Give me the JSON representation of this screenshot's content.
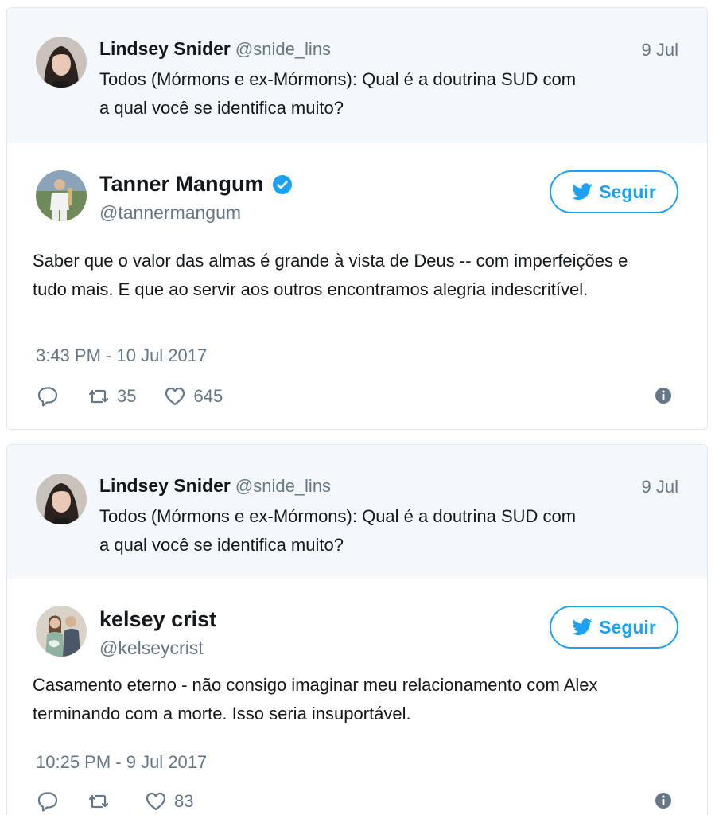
{
  "colors": {
    "accent": "#1da1f2",
    "muted": "#657786",
    "parent_bg": "#f5f8fa"
  },
  "tweets": [
    {
      "parent": {
        "name": "Lindsey Snider",
        "handle": "@snide_lins",
        "date": "9 Jul",
        "text_line1": "Todos (Mórmons e ex-Mórmons): Qual é a doutrina SUD com",
        "text_line2": "a qual você se identifica muito?"
      },
      "author": {
        "name": "Tanner Mangum",
        "handle": "@tannermangum",
        "verified": true,
        "follow_label": "Seguir"
      },
      "text_line1": "Saber que o valor das almas é grande à vista de Deus -- com imperfeições e",
      "text_line2": "tudo mais. E que ao servir aos outros encontramos alegria indescritível.",
      "timestamp": "3:43 PM - 10 Jul 2017",
      "retweets": "35",
      "likes": "645"
    },
    {
      "parent": {
        "name": "Lindsey Snider",
        "handle": "@snide_lins",
        "date": "9 Jul",
        "text_line1": "Todos (Mórmons e ex-Mórmons): Qual é a doutrina SUD com",
        "text_line2": "a qual você se identifica muito?"
      },
      "author": {
        "name": "kelsey crist",
        "handle": "@kelseycrist",
        "verified": false,
        "follow_label": "Seguir"
      },
      "text_line1": "Casamento eterno - não consigo imaginar meu relacionamento com Alex",
      "text_line2": "terminando com a morte. Isso seria insuportável.",
      "timestamp": "10:25 PM - 9 Jul 2017",
      "retweets": "",
      "likes": "83"
    }
  ],
  "icons": [
    "reply-icon",
    "retweet-icon",
    "like-icon",
    "info-icon",
    "twitter-bird-icon",
    "verified-badge-icon"
  ]
}
